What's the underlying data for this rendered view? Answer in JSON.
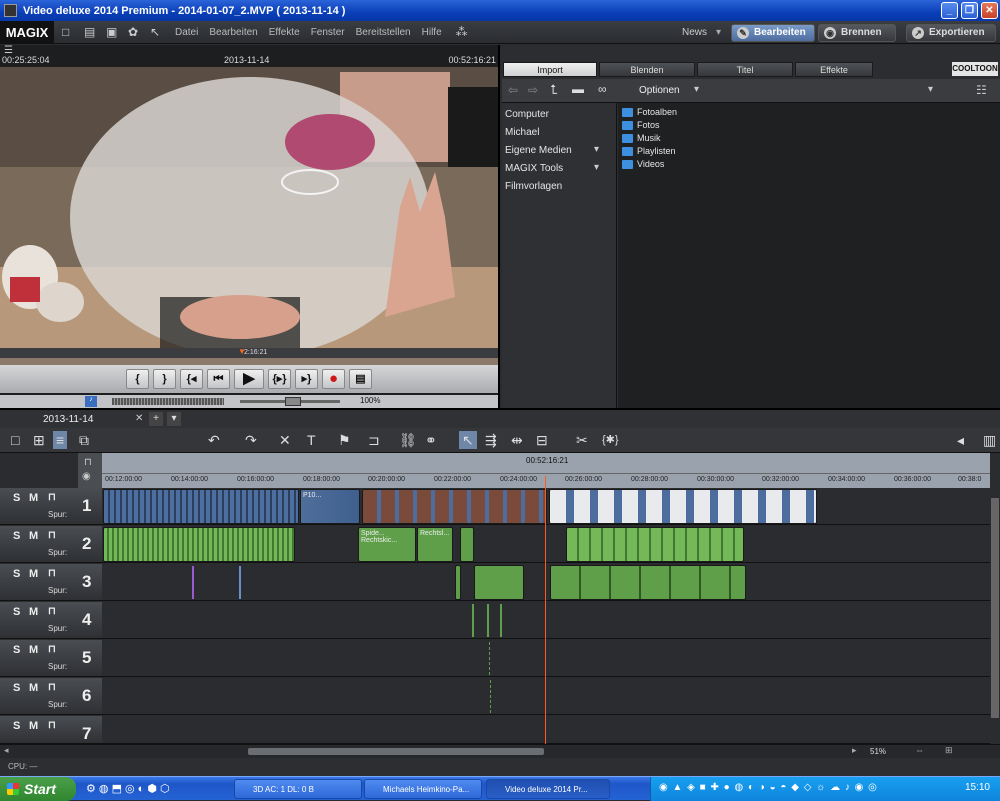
{
  "window": {
    "title": "Video deluxe 2014 Premium - 2014-01-07_2.MVP ( 2013-11-14 )",
    "min": "_",
    "max": "❐",
    "close": "✕"
  },
  "menubar": {
    "logo": "MAGIX",
    "items": [
      "Datei",
      "Bearbeiten",
      "Effekte",
      "Fenster",
      "Bereitstellen",
      "Hilfe"
    ],
    "news": "News",
    "buttons": {
      "edit": "Bearbeiten",
      "burn": "Brennen",
      "export": "Exportieren"
    }
  },
  "preview": {
    "time_left": "00:25:25:04",
    "date": "2013-11-14",
    "time_right": "00:52:16:21",
    "scrub_time": "2:16:21",
    "zoom": "100%"
  },
  "pool": {
    "tabs": [
      "Import",
      "Blenden",
      "Titel",
      "Effekte"
    ],
    "active_tab": "Import",
    "brand": "COOLTOON",
    "options_label": "Optionen",
    "nav": [
      "Computer",
      "Michael",
      "Eigene Medien",
      "MAGIX Tools",
      "Filmvorlagen"
    ],
    "folders": [
      "Fotoalben",
      "Fotos",
      "Musik",
      "Playlisten",
      "Videos"
    ]
  },
  "timeline": {
    "tab": "2013-11-14",
    "playhead_time": "00:52:16:21",
    "ruler": [
      "00:12:00:00",
      "00:14:00:00",
      "00:16:00:00",
      "00:18:00:00",
      "00:20:00:00",
      "00:22:00:00",
      "00:24:00:00",
      "00:26:00:00",
      "00:28:00:00",
      "00:30:00:00",
      "00:32:00:00",
      "00:34:00:00",
      "00:36:00:00",
      "00:38:0"
    ],
    "track_labels": {
      "solo": "S",
      "mute": "M",
      "spur": "Spur:"
    },
    "tracks": [
      "1",
      "2",
      "3",
      "4",
      "5",
      "6",
      "7"
    ],
    "clip_labels": {
      "video": "P10...",
      "audio1": "Spide...",
      "audio2": "Rechtskic...",
      "audio3": "Rechtsl..."
    },
    "zoom_pct": "51%"
  },
  "status": {
    "cpu": "CPU: —"
  },
  "taskbar": {
    "start": "Start",
    "tasks": [
      "3D AC: 1 DL: 0 B",
      "Michaels Heimkino-Pa...",
      "Video deluxe 2014 Pr..."
    ],
    "clock": "15:10"
  }
}
